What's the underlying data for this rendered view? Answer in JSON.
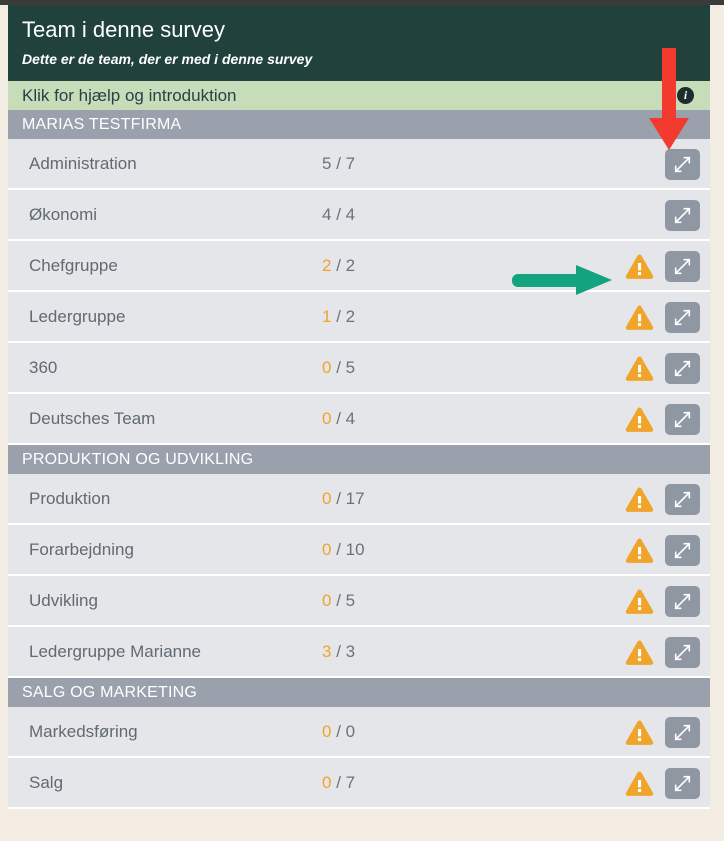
{
  "header": {
    "title": "Team i denne survey",
    "subtitle": "Dette er de team, der er med i denne survey",
    "bg_color": "#21413c"
  },
  "help_bar": {
    "text": "Klik for hjælp og introduktion",
    "info_icon": "info-icon",
    "bg_color": "#c7ddb9"
  },
  "colors": {
    "group_header_bg": "#9aa0ac",
    "row_bg": "#e4e6ea",
    "warning_orange": "#f0a42a",
    "button_gray": "#8f97a3",
    "page_bg": "#f2ece3",
    "red_annotation": "#f23b2e",
    "green_annotation": "#14a37f"
  },
  "groups": [
    {
      "label": "MARIAS TESTFIRMA",
      "rows": [
        {
          "name": "Administration",
          "current": "5",
          "separator": " / ",
          "total": "7",
          "warning": false,
          "action_icon": "compress-arrows-icon"
        },
        {
          "name": "Økonomi",
          "current": "4",
          "separator": " / ",
          "total": "4",
          "warning": false,
          "action_icon": "compress-arrows-icon"
        },
        {
          "name": "Chefgruppe",
          "current": "2",
          "separator": " / ",
          "total": "2",
          "warning": true,
          "action_icon": "compress-arrows-icon"
        },
        {
          "name": "Ledergruppe",
          "current": "1",
          "separator": " / ",
          "total": "2",
          "warning": true,
          "action_icon": "compress-arrows-icon"
        },
        {
          "name": "360",
          "current": "0",
          "separator": " / ",
          "total": "5",
          "warning": true,
          "action_icon": "compress-arrows-icon"
        },
        {
          "name": "Deutsches Team",
          "current": "0",
          "separator": " / ",
          "total": "4",
          "warning": true,
          "action_icon": "compress-arrows-icon"
        }
      ]
    },
    {
      "label": "PRODUKTION OG UDVIKLING",
      "rows": [
        {
          "name": "Produktion",
          "current": "0",
          "separator": " / ",
          "total": "17",
          "warning": true,
          "action_icon": "compress-arrows-icon"
        },
        {
          "name": "Forarbejdning",
          "current": "0",
          "separator": " / ",
          "total": "10",
          "warning": true,
          "action_icon": "compress-arrows-icon"
        },
        {
          "name": "Udvikling",
          "current": "0",
          "separator": " / ",
          "total": "5",
          "warning": true,
          "action_icon": "compress-arrows-icon"
        },
        {
          "name": "Ledergruppe Marianne",
          "current": "3",
          "separator": " / ",
          "total": "3",
          "warning": true,
          "action_icon": "compress-arrows-icon"
        }
      ]
    },
    {
      "label": "SALG OG MARKETING",
      "rows": [
        {
          "name": "Markedsføring",
          "current": "0",
          "separator": " / ",
          "total": "0",
          "warning": true,
          "action_icon": "compress-arrows-icon"
        },
        {
          "name": "Salg",
          "current": "0",
          "separator": " / ",
          "total": "7",
          "warning": true,
          "action_icon": "compress-arrows-icon"
        }
      ]
    }
  ],
  "annotations": [
    {
      "name": "red-down-arrow",
      "direction": "down",
      "color": "#f23b2e"
    },
    {
      "name": "green-right-arrow",
      "direction": "right",
      "color": "#14a37f"
    }
  ]
}
